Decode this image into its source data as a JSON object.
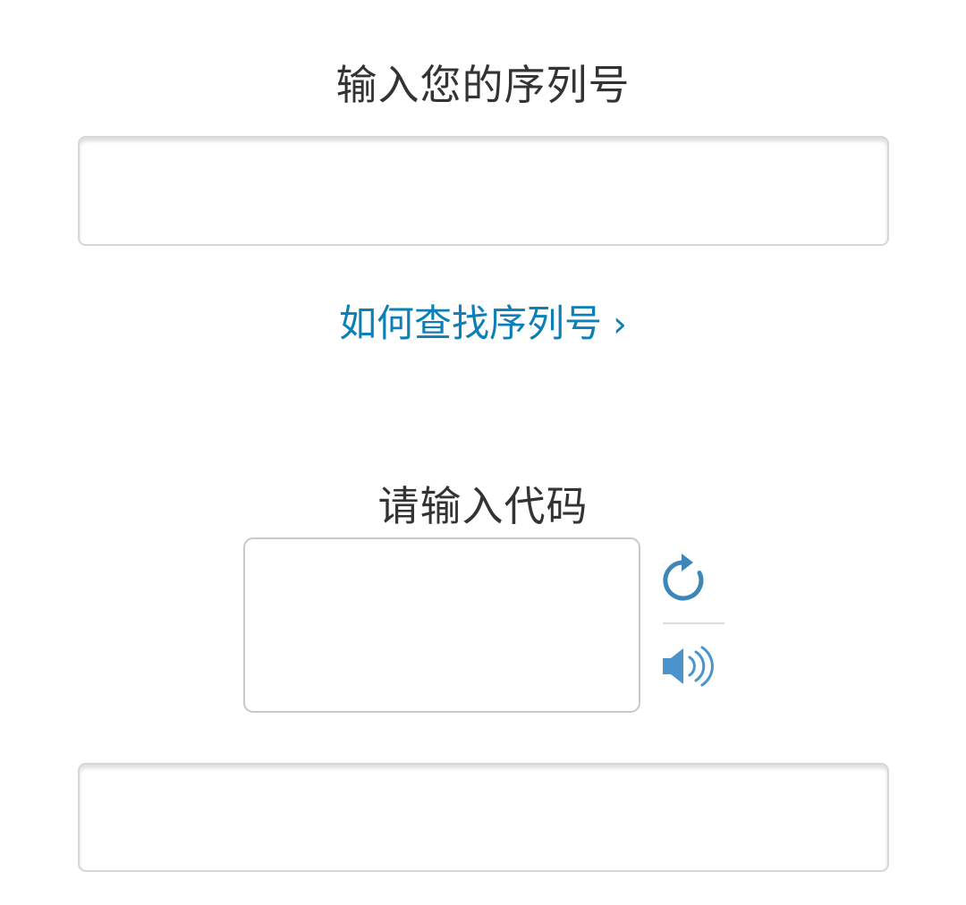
{
  "serial": {
    "title": "输入您的序列号",
    "input_value": "",
    "help_link_label": "如何查找序列号",
    "help_link_chevron": "›"
  },
  "captcha": {
    "title": "请输入代码",
    "refresh_icon": "refresh-icon",
    "audio_icon": "speaker-icon",
    "input_value": ""
  },
  "colors": {
    "text": "#333333",
    "link": "#0c7fb6",
    "icon": "#3c87b8",
    "field_border": "#d6d6d6"
  }
}
